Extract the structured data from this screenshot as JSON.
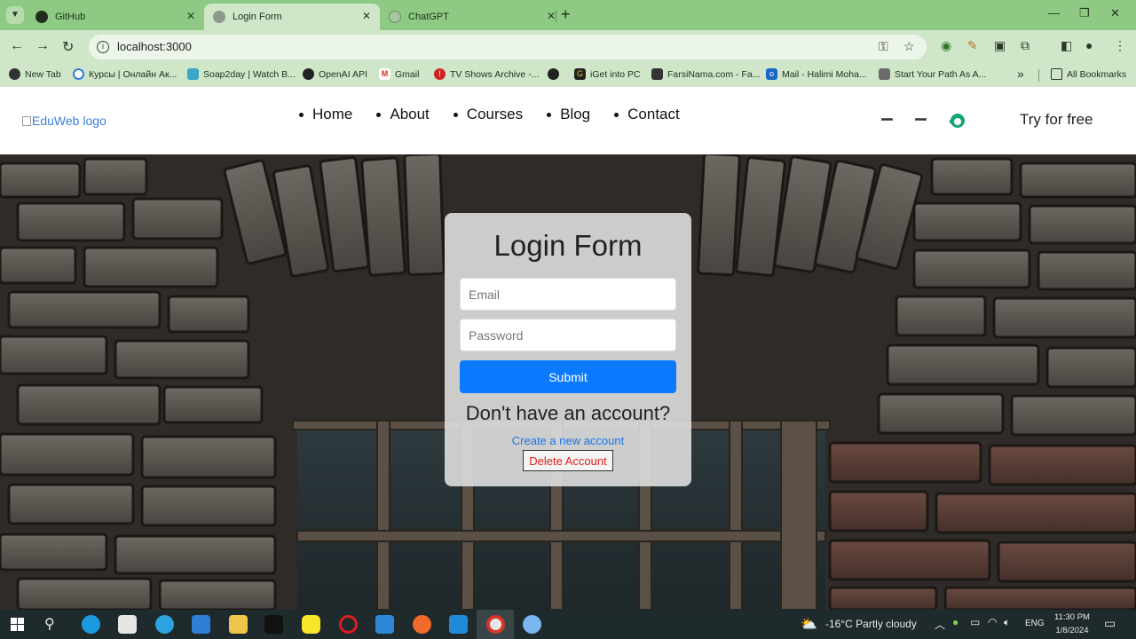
{
  "browser": {
    "tabs": [
      {
        "title": "GitHub",
        "favicon": "github-icon",
        "active": false
      },
      {
        "title": "Login Form",
        "favicon": "globe-icon",
        "active": true
      },
      {
        "title": "ChatGPT",
        "favicon": "globe-icon",
        "active": false
      }
    ],
    "address": "localhost:3000",
    "bookmarks": [
      "New Tab",
      "Курсы | Онлайн Ак...",
      "Soap2day | Watch B...",
      "OpenAI API",
      "Gmail",
      "TV Shows Archive -...",
      "",
      "iGet into PC",
      "FarsiNama.com - Fa...",
      "Mail - Halimi Moha...",
      "Start Your Path As A..."
    ],
    "more_bookmarks": "»",
    "all_bookmarks": "All Bookmarks"
  },
  "site": {
    "logo_alt": "EduWeb logo",
    "nav": [
      "Home",
      "About",
      "Courses",
      "Blog",
      "Contact"
    ],
    "cta": "Try for free"
  },
  "login": {
    "title": "Login Form",
    "email_placeholder": "Email",
    "password_placeholder": "Password",
    "submit": "Submit",
    "no_account": "Don't have an account?",
    "create_link": "Create a new account",
    "delete": "Delete Account"
  },
  "taskbar": {
    "weather": "-16°C  Partly cloudy",
    "language": "ENG",
    "time": "11:30 PM",
    "date": "1/8/2024"
  },
  "colors": {
    "browser_frame": "#8fca84",
    "submit": "#0a7bff",
    "link": "#1a73e8",
    "delete_text": "#e0201a"
  }
}
